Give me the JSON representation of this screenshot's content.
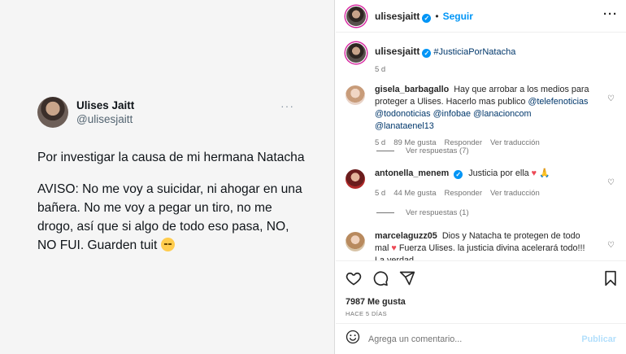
{
  "tweet": {
    "name": "Ulises Jaitt",
    "handle": "@ulisesjaitt",
    "more": "···",
    "line1": "Por investigar la causa de mi hermana Natacha",
    "line2": "AVISO: No me voy a suicidar, ni ahogar en una bañera. No me voy a pegar un tiro, no me drogo, así que si algo de todo eso pasa, NO, NO FUI. Guarden tuit",
    "emoji": "disappointed-face-emoji"
  },
  "post": {
    "username": "ulisesjaitt",
    "verified": "✓",
    "separator": "•",
    "follow_label": "Seguir",
    "more": "···",
    "caption": {
      "username": "ulisesjaitt",
      "hashtag": "#JusticiaPorNatacha",
      "time": "5 d"
    },
    "comments": [
      {
        "user": "gisela_barbagallo",
        "text": "Hay que arrobar a los medios para proteger a Ulises. Hacerlo mas publico",
        "mentions": "@telefenoticias @todonoticias @infobae @lanacioncom @lanataenel13",
        "time": "5 d",
        "likes": "89 Me gusta",
        "reply": "Responder",
        "translate": "Ver traducción",
        "replies": "Ver respuestas (7)"
      },
      {
        "user": "antonella_menem",
        "text": "Justicia por ella",
        "time": "5 d",
        "likes": "44 Me gusta",
        "reply": "Responder",
        "translate": "Ver traducción",
        "replies": "Ver respuestas (1)"
      },
      {
        "user": "marcelaguzz05",
        "text": "Dios y Natacha te protegen de todo mal",
        "text2": "Fuerza Ulises. la justicia divina acelerará todo!!! La verdad"
      }
    ],
    "likes": "7987 Me gusta",
    "ago": "HACE 5 DÍAS",
    "comment_placeholder": "Agrega un comentario...",
    "publish_label": "Publicar"
  },
  "colors": {
    "accent": "#0095f6",
    "mention": "#00376b",
    "heart": "#ed4956",
    "muted": "#737373"
  }
}
